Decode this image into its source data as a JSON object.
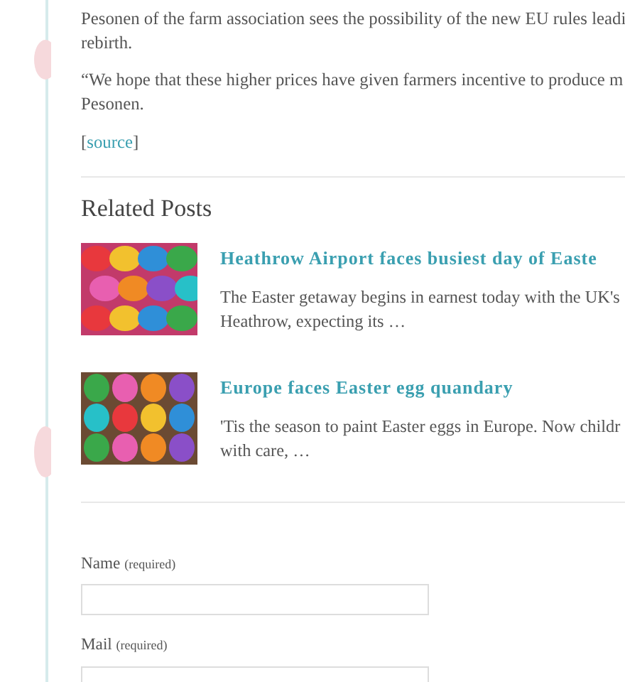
{
  "article": {
    "paragraphs": [
      {
        "lines": [
          "Pesonen of the farm association sees the possibility of the new EU rules leadi",
          "rebirth."
        ]
      },
      {
        "lines": [
          "“We hope that these higher prices have given farmers incentive to produce m",
          "Pesonen."
        ]
      }
    ],
    "source": {
      "open": "[",
      "link": "source",
      "close": "]"
    }
  },
  "related_posts": {
    "title": "Related Posts",
    "items": [
      {
        "kind": "picture",
        "title": "Heathrow Airport faces busiest day of Easte",
        "excerpt_lines": [
          "The Easter getaway begins in earnest today with the UK's",
          "Heathrow, expecting its …"
        ]
      },
      {
        "kind": "picture",
        "title": "Europe faces Easter egg quandary",
        "excerpt_lines": [
          "'Tis the season to paint Easter eggs in Europe. Now childr",
          "with care, …"
        ]
      }
    ]
  },
  "comment_form": {
    "fields": [
      {
        "label": "Name",
        "note": "(required)"
      },
      {
        "label": "Mail",
        "note": "(required)"
      }
    ]
  }
}
